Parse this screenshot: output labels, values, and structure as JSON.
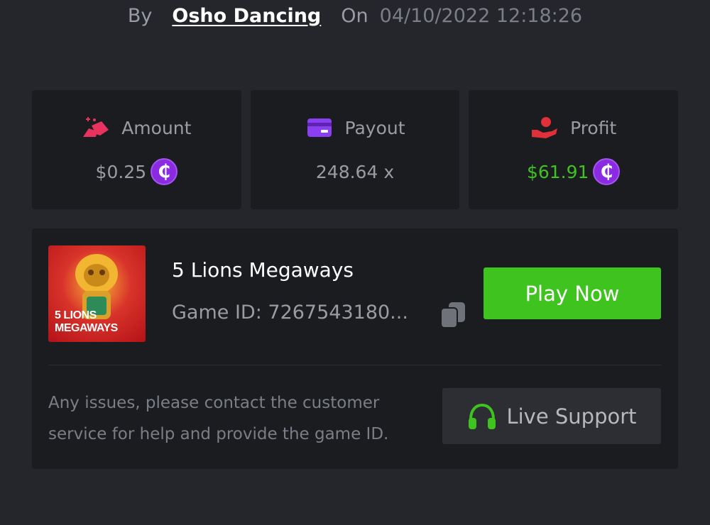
{
  "byline": {
    "by_label": "By",
    "user": "Osho Dancing",
    "on_label": "On",
    "timestamp": "04/10/2022 12:18:26"
  },
  "stats": [
    {
      "label": "Amount",
      "value": "$0.25",
      "icon": "coins-stack-icon",
      "color": "#e8335f",
      "has_coin": true
    },
    {
      "label": "Payout",
      "value": "248.64 x",
      "icon": "card-icon",
      "color": "#8a3ff0",
      "has_coin": false
    },
    {
      "label": "Profit",
      "value": "$61.91",
      "icon": "hand-coin-icon",
      "color": "#e0303a",
      "has_coin": true,
      "value_color": "#3ec31f"
    }
  ],
  "coin_symbol": "₵",
  "game": {
    "thumbnail_text": [
      "5 LIONS",
      "MEGAWAYS"
    ],
    "name": "5 Lions Megaways",
    "id_text": "Game ID: 7267543180...",
    "play_label": "Play Now"
  },
  "help": {
    "text": "Any issues, please contact the customer service for help and provide the game ID.",
    "support_label": "Live Support"
  },
  "colors": {
    "background": "#24262b",
    "card": "#1b1c20",
    "accent_green": "#3ec31f",
    "coin_purple": "#8a2be2"
  }
}
